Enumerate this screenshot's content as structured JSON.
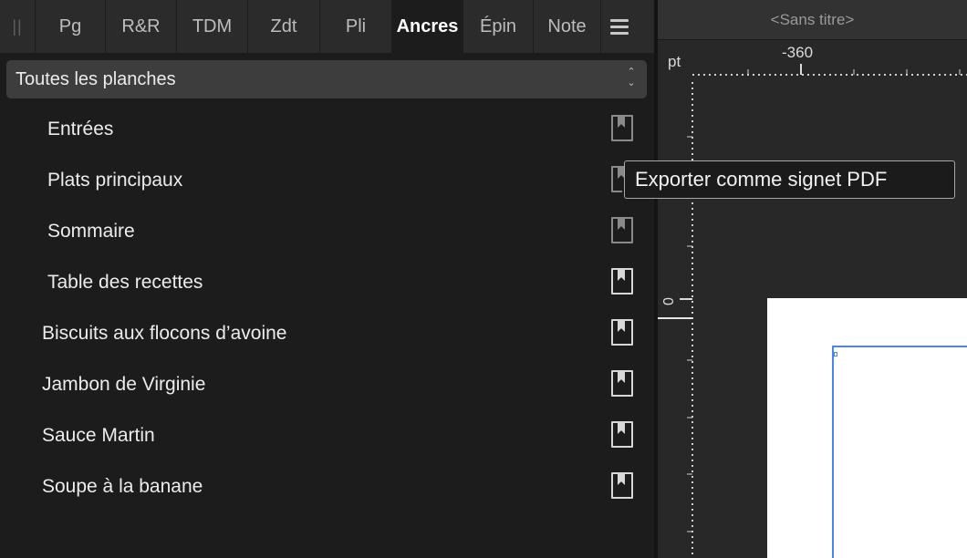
{
  "panel": {
    "tabs": [
      {
        "label": "Pg",
        "active": false
      },
      {
        "label": "R&R",
        "active": false
      },
      {
        "label": "TDM",
        "active": false
      },
      {
        "label": "Zdt",
        "active": false
      },
      {
        "label": "Pli",
        "active": false
      },
      {
        "label": "Ancres",
        "active": true
      },
      {
        "label": "Épin",
        "active": false
      },
      {
        "label": "Note",
        "active": false
      }
    ],
    "menu_icon": "hamburger-menu-icon",
    "scope_select": {
      "value": "Toutes les planches"
    },
    "anchors": [
      {
        "label": "Entrées",
        "level": "child",
        "bookmark_state": "dim"
      },
      {
        "label": "Plats principaux",
        "level": "child",
        "bookmark_state": "dim"
      },
      {
        "label": "Sommaire",
        "level": "child",
        "bookmark_state": "dim"
      },
      {
        "label": "Table des recettes",
        "level": "child",
        "bookmark_state": "active"
      },
      {
        "label": "Biscuits aux flocons d’avoine",
        "level": "top",
        "bookmark_state": "active"
      },
      {
        "label": "Jambon de Virginie",
        "level": "top",
        "bookmark_state": "active"
      },
      {
        "label": "Sauce Martin",
        "level": "top",
        "bookmark_state": "active"
      },
      {
        "label": "Soupe à la banane",
        "level": "top",
        "bookmark_state": "active"
      }
    ],
    "bookmark_icon": "pdf-bookmark-icon"
  },
  "tooltip": {
    "text": "Exporter comme signet PDF"
  },
  "document": {
    "title": "<Sans titre>",
    "ruler_unit": "pt",
    "ruler_h_label": "-360",
    "ruler_v_label": "0"
  },
  "colors": {
    "panel_bg": "#1c1c1c",
    "tabbar_bg": "#2b2b2b",
    "select_bg": "#3d3d3d",
    "frame_accent": "#4a86e8"
  }
}
